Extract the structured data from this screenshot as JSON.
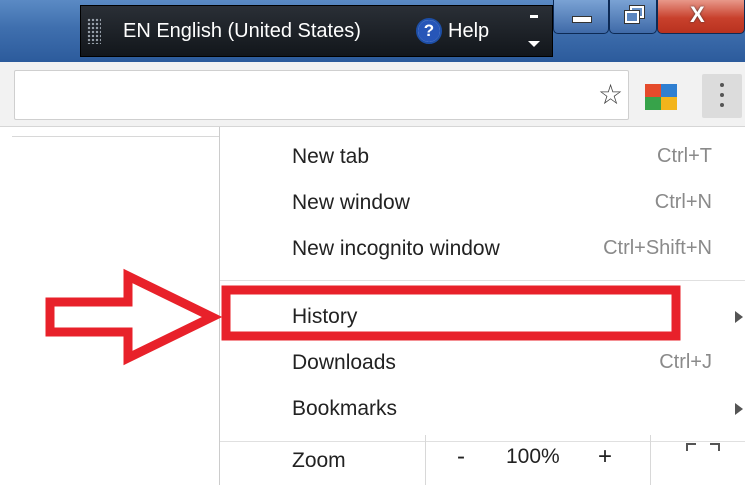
{
  "language_bar": {
    "language_label": "EN English (United States)",
    "help_label": "Help"
  },
  "window_controls": {
    "minimize_icon": "minimize-icon",
    "maximize_icon": "restore-icon",
    "close_label": "X"
  },
  "toolbar": {
    "bookmark_icon": "star-icon",
    "extension_icon": "avg-extension-icon",
    "menu_icon": "vertical-dots-icon"
  },
  "menu": {
    "items_group1": [
      {
        "label": "New tab",
        "shortcut": "Ctrl+T"
      },
      {
        "label": "New window",
        "shortcut": "Ctrl+N"
      },
      {
        "label": "New incognito window",
        "shortcut": "Ctrl+Shift+N"
      }
    ],
    "items_group2": [
      {
        "label": "History",
        "shortcut": "",
        "submenu": true,
        "highlighted": true
      },
      {
        "label": "Downloads",
        "shortcut": "Ctrl+J",
        "submenu": false
      },
      {
        "label": "Bookmarks",
        "shortcut": "",
        "submenu": true
      }
    ],
    "zoom": {
      "label": "Zoom",
      "minus": "-",
      "value": "100%",
      "plus": "+"
    }
  },
  "annotation": {
    "color": "#e8212a",
    "target": "History"
  }
}
